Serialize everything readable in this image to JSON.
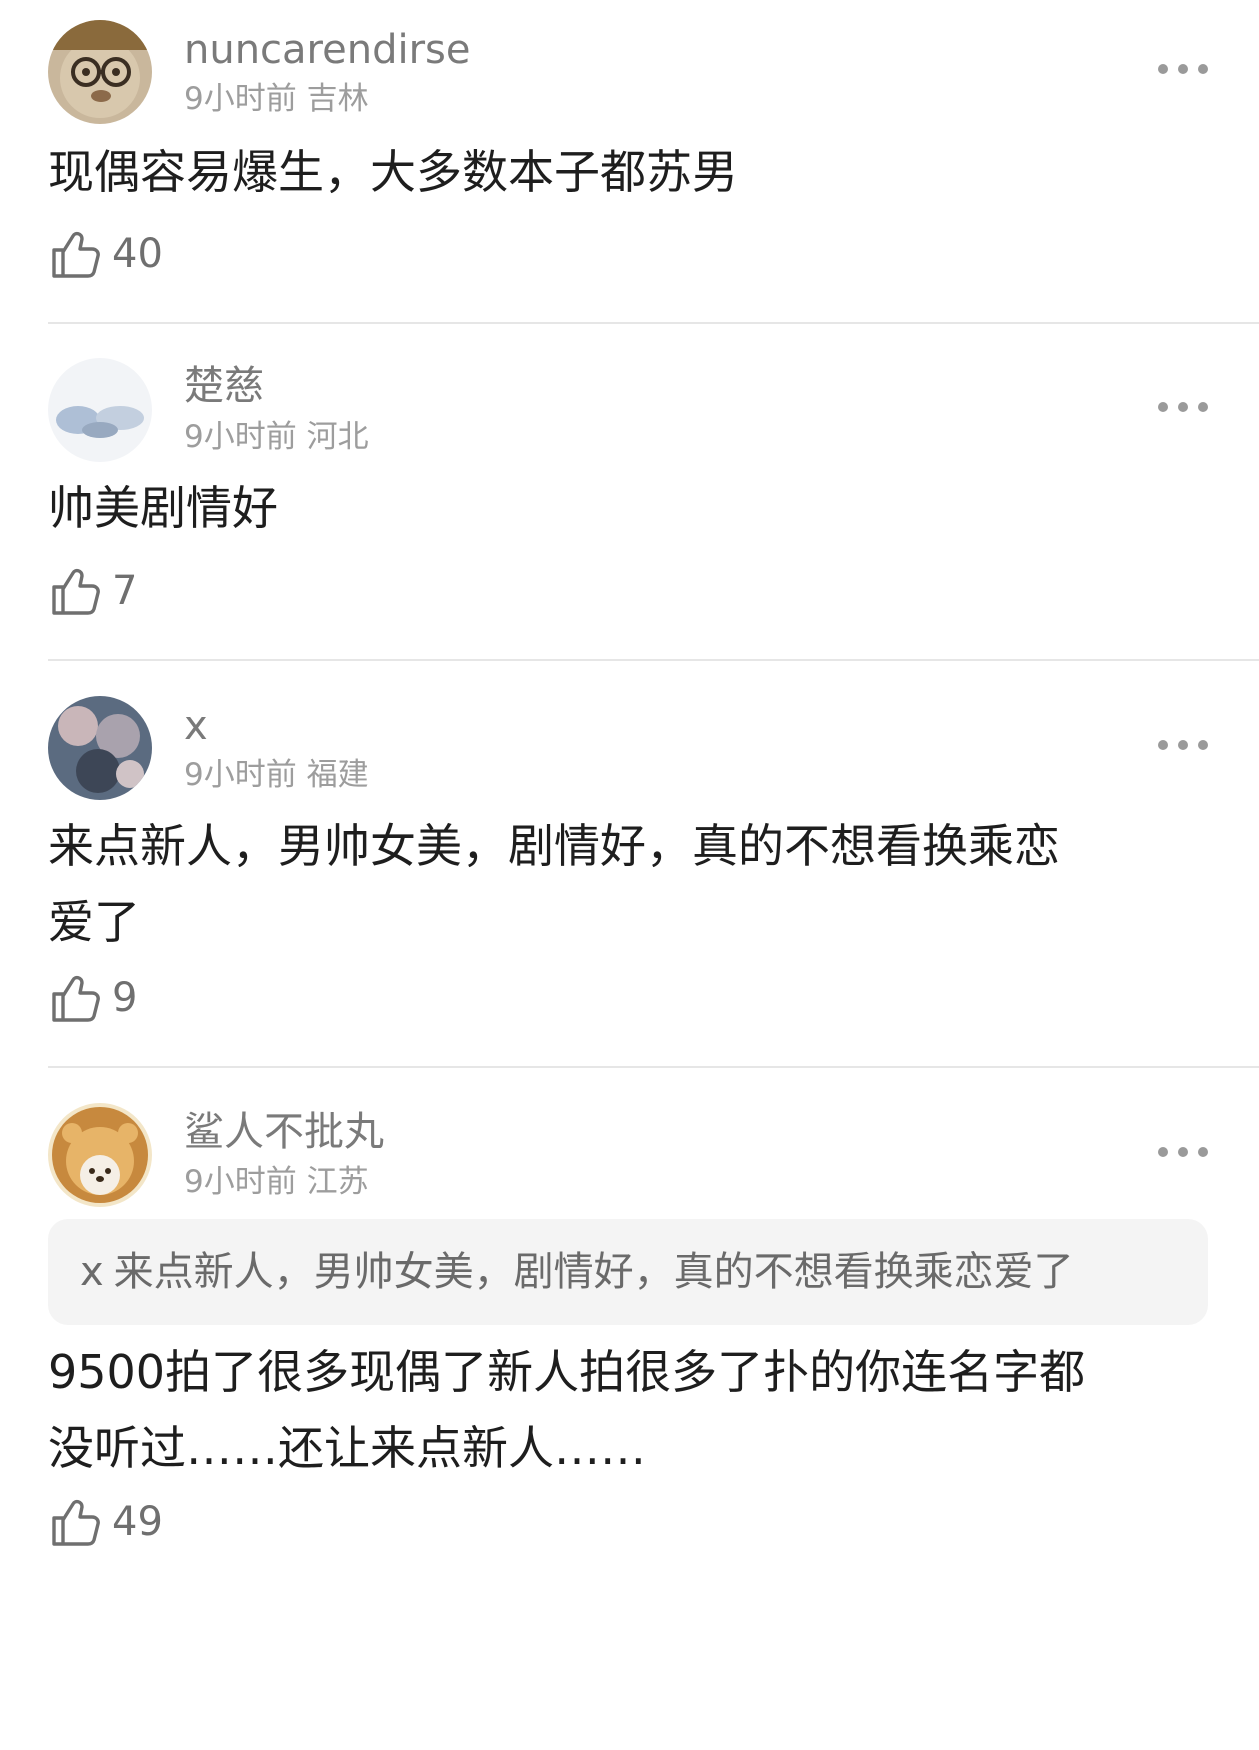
{
  "comments": [
    {
      "username": "nuncarendirse",
      "time": "9小时前",
      "location": "吉林",
      "text": "现偶容易爆生，大多数本子都苏男",
      "likes": "40"
    },
    {
      "username": "楚慈",
      "time": "9小时前",
      "location": "河北",
      "text": "帅美剧情好",
      "likes": "7"
    },
    {
      "username": "x",
      "time": "9小时前",
      "location": "福建",
      "text": "来点新人，男帅女美，剧情好，真的不想看换乘恋\n爱了",
      "likes": "9"
    },
    {
      "username": "鲨人不批丸",
      "time": "9小时前",
      "location": "江苏",
      "quote": {
        "user": "x",
        "text": "来点新人，男帅女美，剧情好，真的不想看换乘恋爱了"
      },
      "text": "9500拍了很多现偶了新人拍很多了扑的你连名字都\n没听过……还让来点新人……",
      "likes": "49"
    }
  ],
  "icons": {
    "like": "thumbs-up-icon",
    "more": "more-dots-icon"
  },
  "colors": {
    "username": "#7a7a7a",
    "meta": "#9d9d9d",
    "text": "#1e1e1e",
    "divider": "#e6e6e6",
    "quote_bg": "#f4f4f4"
  }
}
